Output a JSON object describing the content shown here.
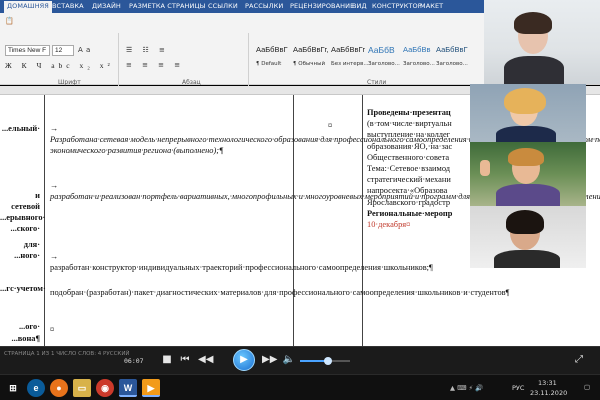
{
  "ribbon": {
    "tabs": [
      "ДОМАШНЯЯ",
      "ВСТАВКА",
      "ДИЗАЙН",
      "РАЗМЕТКА СТРАНИЦЫ",
      "ССЫЛКИ",
      "РАССЫЛКИ",
      "РЕЦЕНЗИРОВАНИЕ",
      "ВИД",
      "КОНСТРУКТОР",
      "МАКЕТ"
    ],
    "active_tab": "ДОМАШНЯЯ",
    "font_name": "Times New F",
    "font_size": "12",
    "format_buttons": "Ж К Ч  abc x₂ x²",
    "group_font": "Шрифт",
    "group_paragraph": "Абзац",
    "group_styles": "Стили",
    "styles": [
      {
        "sample": "АаБбВвГ",
        "name": "¶ Default"
      },
      {
        "sample": "АаБбВвГг,",
        "name": "¶ Обычный"
      },
      {
        "sample": "АаБбВвГг",
        "name": "Без интерв..."
      },
      {
        "sample": "АаБбВ",
        "name": "Заголово..."
      },
      {
        "sample": "АаБбВв",
        "name": "Заголово..."
      },
      {
        "sample": "АаБбВвГ",
        "name": "Заголово..."
      }
    ]
  },
  "document": {
    "left_fragments": [
      "...",
      "...ельный·",
      "",
      "",
      "",
      "и",
      "сетевой",
      "...ерывного·",
      "...ского·",
      "для·",
      "...ного·",
      "...",
      "...гс·учетом·",
      "",
      "",
      "...ого·",
      "...вона¶"
    ],
    "middle_items": [
      {
        "bullet": "•",
        "text": "→ Разработана·сетевая·модель·непрерывного·технологического·образования·для·профессионального·самоопределения·и·развития·обучающихся·с·учетом·перспектив·социально-экономического·развития·региона·(выполнено);¶",
        "italic": true
      },
      {
        "bullet": "•",
        "text": "→ разработан·и·реализован·портфель·вариативных,·многопрофильных·и·многоуровневых·мероприятий·и·программ·для·профессионального·самоопределения·школьников;·для·профессиональной·идентичности·студентов·(выполнено);¶",
        "italic": true
      },
      {
        "bullet": "•",
        "text": "→ разработан·конструктор·индивидуальных·траекторий·профессионального·самоопределения·школьников;¶",
        "italic": false
      },
      {
        "bullet": "•",
        "text": "подобран·(разработан)·пакет·диагностических·материалов·для·профессионального·самоопределения·школьников·и·студентов¶",
        "italic": false
      }
    ],
    "cell_end_mark": "¤",
    "right_lines": [
      {
        "text": "Проведены·презентац",
        "bold": true
      },
      {
        "text": "(в·том·числе·виртуальн",
        "bold": false
      },
      {
        "text": "выступление·на·коллег",
        "bold": false
      },
      {
        "text": "образования·ЯО,·на·зас",
        "bold": false
      },
      {
        "text": "Общественного·совета",
        "bold": false
      },
      {
        "text": "Тема:·Сетевое·взаимод",
        "bold": false
      },
      {
        "text": "стратегический·механи",
        "bold": false
      },
      {
        "text": "напросекта·«Образова",
        "bold": false
      },
      {
        "text": "Ярославского·градостр",
        "bold": false
      },
      {
        "text": "Региональные·меропр",
        "bold": true
      },
      {
        "text": "10·декабря¤",
        "bold": false,
        "red": true
      }
    ]
  },
  "media": {
    "status_left": "СТРАНИЦА 1 ИЗ 1   ЧИСЛО СЛОВ: 4   РУССКИЙ",
    "time": "06:07",
    "volume": 0.55
  },
  "taskbar": {
    "word_label": "W",
    "lang": "РУС",
    "clock_time": "13:31",
    "clock_date": "23.11.2020"
  }
}
